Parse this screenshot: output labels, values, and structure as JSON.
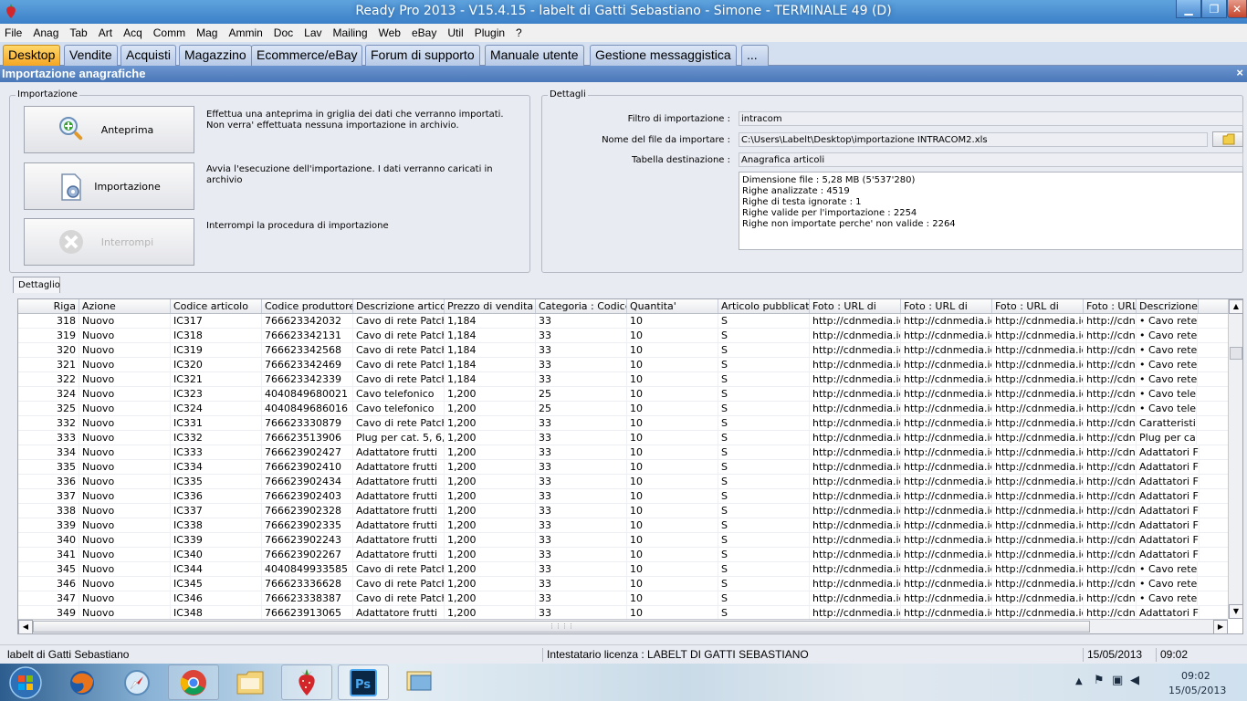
{
  "window": {
    "title": "Ready Pro 2013 - V15.4.15 - labelt di Gatti Sebastiano - Simone - TERMINALE 49 (D)"
  },
  "menu": [
    "File",
    "Anag",
    "Tab",
    "Art",
    "Acq",
    "Comm",
    "Mag",
    "Ammin",
    "Doc",
    "Lav",
    "Mailing",
    "Web",
    "eBay",
    "Util",
    "Plugin",
    "?"
  ],
  "tabs": [
    {
      "label": "Desktop",
      "active": true
    },
    {
      "label": "Vendite"
    },
    {
      "label": "Acquisti"
    },
    {
      "label": "Magazzino"
    },
    {
      "label": "Ecommerce/eBay"
    },
    {
      "label": "Forum di supporto"
    },
    {
      "label": "Manuale utente"
    },
    {
      "label": "Gestione messaggistica"
    },
    {
      "label": "..."
    }
  ],
  "panel": {
    "title": "Importazione anagrafiche",
    "close": "×"
  },
  "import_group": {
    "label": "Importazione",
    "preview": {
      "label": "Anteprima",
      "desc": "Effettua una anteprima in griglia dei dati che verranno importati. Non verra' effettuata nessuna importazione in archivio."
    },
    "import": {
      "label": "Importazione",
      "desc": "Avvia l'esecuzione dell'importazione. I dati verranno caricati in archivio"
    },
    "stop": {
      "label": "Interrompi",
      "desc": "Interrompi la procedura di importazione"
    }
  },
  "details_group": {
    "label": "Dettagli",
    "filter_label": "Filtro di importazione :",
    "filter_value": "intracom",
    "file_label": "Nome del file da importare :",
    "file_value": "C:\\Users\\Labelt\\Desktop\\importazione INTRACOM2.xls",
    "table_label": "Tabella destinazione :",
    "table_value": "Anagrafica articoli",
    "log": [
      "Dimensione file : 5,28 MB (5'537'280)",
      "Righe analizzate : 4519",
      "Righe di testa ignorate : 1",
      "Righe valide per l'importazione : 2254",
      "Righe non importate perche' non valide : 2264"
    ]
  },
  "grid": {
    "tab_label": "Dettaglio",
    "columns": [
      "Riga",
      "Azione",
      "Codice articolo",
      "Codice produttore",
      "Descrizione articolo",
      "Prezzo di vendita",
      "Categoria : Codice",
      "Quantita'",
      "Articolo pubblicato",
      "Foto : URL di",
      "Foto : URL di",
      "Foto : URL di",
      "Foto : URL di",
      "Descrizione"
    ],
    "rows": [
      [
        "318",
        "Nuovo",
        "IC317",
        "766623342032",
        "Cavo di rete Patch",
        "1,184",
        "33",
        "10",
        "S",
        "http://cdnmedia.ici",
        "http://cdnmedia.ici",
        "http://cdnmedia.ici",
        "http://cdnmedia.ici",
        "• Cavo rete"
      ],
      [
        "319",
        "Nuovo",
        "IC318",
        "766623342131",
        "Cavo di rete Patch",
        "1,184",
        "33",
        "10",
        "S",
        "http://cdnmedia.ici",
        "http://cdnmedia.ici",
        "http://cdnmedia.ici",
        "http://cdnmedia.ici",
        "• Cavo rete"
      ],
      [
        "320",
        "Nuovo",
        "IC319",
        "766623342568",
        "Cavo di rete Patch",
        "1,184",
        "33",
        "10",
        "S",
        "http://cdnmedia.ici",
        "http://cdnmedia.ici",
        "http://cdnmedia.ici",
        "http://cdnmedia.ici",
        "• Cavo rete"
      ],
      [
        "321",
        "Nuovo",
        "IC320",
        "766623342469",
        "Cavo di rete Patch",
        "1,184",
        "33",
        "10",
        "S",
        "http://cdnmedia.ici",
        "http://cdnmedia.ici",
        "http://cdnmedia.ici",
        "http://cdnmedia.ici",
        "• Cavo rete"
      ],
      [
        "322",
        "Nuovo",
        "IC321",
        "766623342339",
        "Cavo di rete Patch",
        "1,184",
        "33",
        "10",
        "S",
        "http://cdnmedia.ici",
        "http://cdnmedia.ici",
        "http://cdnmedia.ici",
        "http://cdnmedia.ici",
        "• Cavo rete"
      ],
      [
        "324",
        "Nuovo",
        "IC323",
        "4040849680021",
        "Cavo telefonico",
        "1,200",
        "25",
        "10",
        "S",
        "http://cdnmedia.ici",
        "http://cdnmedia.ici",
        "http://cdnmedia.ici",
        "http://cdnmedia.ici",
        "• Cavo tele"
      ],
      [
        "325",
        "Nuovo",
        "IC324",
        "4040849686016",
        "Cavo telefonico",
        "1,200",
        "25",
        "10",
        "S",
        "http://cdnmedia.ici",
        "http://cdnmedia.ici",
        "http://cdnmedia.ici",
        "http://cdnmedia.ici",
        "• Cavo tele"
      ],
      [
        "332",
        "Nuovo",
        "IC331",
        "766623330879",
        "Cavo di rete Patch",
        "1,200",
        "33",
        "10",
        "S",
        "http://cdnmedia.ici",
        "http://cdnmedia.ici",
        "http://cdnmedia.ici",
        "http://cdnmedia.ici",
        "Caratteristi"
      ],
      [
        "333",
        "Nuovo",
        "IC332",
        "766623513906",
        "Plug per cat. 5, 6,",
        "1,200",
        "33",
        "10",
        "S",
        "http://cdnmedia.ici",
        "http://cdnmedia.ici",
        "http://cdnmedia.ici",
        "http://cdnmedia.ici",
        "Plug per ca"
      ],
      [
        "334",
        "Nuovo",
        "IC333",
        "766623902427",
        "Adattatore frutti",
        "1,200",
        "33",
        "10",
        "S",
        "http://cdnmedia.ici",
        "http://cdnmedia.ici",
        "http://cdnmedia.ici",
        "http://cdnmedia.ici",
        "Adattatori F"
      ],
      [
        "335",
        "Nuovo",
        "IC334",
        "766623902410",
        "Adattatore frutti",
        "1,200",
        "33",
        "10",
        "S",
        "http://cdnmedia.ici",
        "http://cdnmedia.ici",
        "http://cdnmedia.ici",
        "http://cdnmedia.ici",
        "Adattatori F"
      ],
      [
        "336",
        "Nuovo",
        "IC335",
        "766623902434",
        "Adattatore frutti",
        "1,200",
        "33",
        "10",
        "S",
        "http://cdnmedia.ici",
        "http://cdnmedia.ici",
        "http://cdnmedia.ici",
        "http://cdnmedia.ici",
        "Adattatori F"
      ],
      [
        "337",
        "Nuovo",
        "IC336",
        "766623902403",
        "Adattatore frutti",
        "1,200",
        "33",
        "10",
        "S",
        "http://cdnmedia.ici",
        "http://cdnmedia.ici",
        "http://cdnmedia.ici",
        "http://cdnmedia.ici",
        "Adattatori F"
      ],
      [
        "338",
        "Nuovo",
        "IC337",
        "766623902328",
        "Adattatore frutti",
        "1,200",
        "33",
        "10",
        "S",
        "http://cdnmedia.ici",
        "http://cdnmedia.ici",
        "http://cdnmedia.ici",
        "http://cdnmedia.ici",
        "Adattatori F"
      ],
      [
        "339",
        "Nuovo",
        "IC338",
        "766623902335",
        "Adattatore frutti",
        "1,200",
        "33",
        "10",
        "S",
        "http://cdnmedia.ici",
        "http://cdnmedia.ici",
        "http://cdnmedia.ici",
        "http://cdnmedia.ici",
        "Adattatori F"
      ],
      [
        "340",
        "Nuovo",
        "IC339",
        "766623902243",
        "Adattatore frutti",
        "1,200",
        "33",
        "10",
        "S",
        "http://cdnmedia.ici",
        "http://cdnmedia.ici",
        "http://cdnmedia.ici",
        "http://cdnmedia.ici",
        "Adattatori F"
      ],
      [
        "341",
        "Nuovo",
        "IC340",
        "766623902267",
        "Adattatore frutti",
        "1,200",
        "33",
        "10",
        "S",
        "http://cdnmedia.ici",
        "http://cdnmedia.ici",
        "http://cdnmedia.ici",
        "http://cdnmedia.ici",
        "Adattatori F"
      ],
      [
        "345",
        "Nuovo",
        "IC344",
        "4040849933585",
        "Cavo di rete Patch",
        "1,200",
        "33",
        "10",
        "S",
        "http://cdnmedia.ici",
        "http://cdnmedia.ici",
        "http://cdnmedia.ici",
        "http://cdnmedia.ici",
        "• Cavo rete"
      ],
      [
        "346",
        "Nuovo",
        "IC345",
        "766623336628",
        "Cavo di rete Patch",
        "1,200",
        "33",
        "10",
        "S",
        "http://cdnmedia.ici",
        "http://cdnmedia.ici",
        "http://cdnmedia.ici",
        "http://cdnmedia.ici",
        "• Cavo rete"
      ],
      [
        "347",
        "Nuovo",
        "IC346",
        "766623338387",
        "Cavo di rete Patch",
        "1,200",
        "33",
        "10",
        "S",
        "http://cdnmedia.ici",
        "http://cdnmedia.ici",
        "http://cdnmedia.ici",
        "http://cdnmedia.ici",
        "• Cavo rete"
      ],
      [
        "349",
        "Nuovo",
        "IC348",
        "766623913065",
        "Adattatore frutti",
        "1,200",
        "33",
        "10",
        "S",
        "http://cdnmedia.ici",
        "http://cdnmedia.ici",
        "http://cdnmedia.ici",
        "http://cdnmedia.ici",
        "Adattatori F"
      ]
    ]
  },
  "status": {
    "user": "labelt di Gatti Sebastiano",
    "license": "Intestatario licenza : LABELT DI GATTI SEBASTIANO",
    "date": "15/05/2013",
    "time": "09:02"
  },
  "taskbar": {
    "apps": [
      "start-orb",
      "firefox",
      "safari",
      "chrome",
      "explorer",
      "ready-pro",
      "photoshop",
      "remote-desktop"
    ],
    "clock_time": "09:02",
    "clock_date": "15/05/2013"
  },
  "colors": {
    "active_tab": "#f5a623",
    "panel_header": "#4a77b8",
    "titlebar": "#3c80c8"
  }
}
